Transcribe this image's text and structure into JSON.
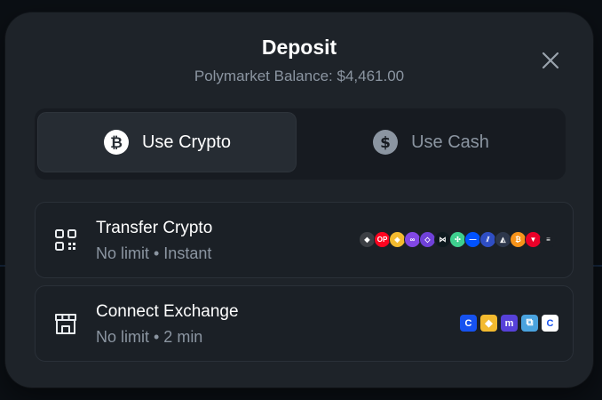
{
  "modal": {
    "title": "Deposit",
    "balance_text": "Polymarket Balance: $4,461.00"
  },
  "tabs": [
    {
      "label": "Use Crypto",
      "icon": "bitcoin-icon",
      "active": true
    },
    {
      "label": "Use Cash",
      "icon": "dollar-icon",
      "active": false
    }
  ],
  "options": [
    {
      "title": "Transfer Crypto",
      "subtitle": "No limit • Instant",
      "icon": "qr-code-icon",
      "chains": [
        {
          "name": "ethereum",
          "color": "#3c3f44",
          "glyph": "◆"
        },
        {
          "name": "optimism",
          "color": "#ff0420",
          "glyph": "OP"
        },
        {
          "name": "bnb",
          "color": "#f3ba2f",
          "glyph": "◈"
        },
        {
          "name": "polygon",
          "color": "#8247e5",
          "glyph": "∞"
        },
        {
          "name": "polygon-pos",
          "color": "#6f41d8",
          "glyph": "◇"
        },
        {
          "name": "hyperliquid",
          "color": "#0f1a1f",
          "glyph": "⋈"
        },
        {
          "name": "abstract",
          "color": "#3ecf8e",
          "glyph": "✣"
        },
        {
          "name": "base",
          "color": "#0052ff",
          "glyph": "—"
        },
        {
          "name": "zksync",
          "color": "#2f4ec4",
          "glyph": "⫽"
        },
        {
          "name": "arbitrum",
          "color": "#2d374b",
          "glyph": "◭"
        },
        {
          "name": "bitcoin",
          "color": "#f7931a",
          "glyph": "₿"
        },
        {
          "name": "tron",
          "color": "#eb0029",
          "glyph": "▼"
        },
        {
          "name": "solana",
          "color": "#1b2026",
          "glyph": "≡"
        }
      ]
    },
    {
      "title": "Connect Exchange",
      "subtitle": "No limit • 2 min",
      "icon": "storefront-icon",
      "exchanges": [
        {
          "name": "coinbase",
          "color": "#1652f0",
          "glyph": "C"
        },
        {
          "name": "binance",
          "color": "#f3ba2f",
          "glyph": "◆"
        },
        {
          "name": "kraken",
          "color": "#5741d9",
          "glyph": "m"
        },
        {
          "name": "crypto-com",
          "color": "#4aa3df",
          "glyph": "⧉"
        },
        {
          "name": "coinbase-alt",
          "color": "#ffffff",
          "glyph": "C"
        }
      ]
    }
  ]
}
